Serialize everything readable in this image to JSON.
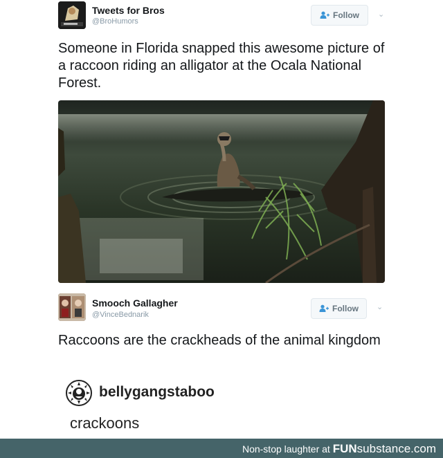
{
  "tweet1": {
    "name": "Tweets for Bros",
    "handle": "@BroHumors",
    "follow_label": "Follow",
    "text": "Someone in Florida snapped this awesome picture of a raccoon riding an alligator at the Ocala National Forest."
  },
  "tweet2": {
    "name": "Smooch Gallagher",
    "handle": "@VinceBednarik",
    "follow_label": "Follow",
    "text": "Raccoons are the crackheads of the animal kingdom"
  },
  "tumblr": {
    "username": "bellygangstaboo",
    "post": "crackoons"
  },
  "footer": {
    "tagline": "Non-stop laughter at ",
    "brand_bold": "FUN",
    "brand_light": "substance",
    "brand_suffix": ".com"
  },
  "icons": {
    "follow": "add-user-icon",
    "more": "chevron-down-icon"
  },
  "colors": {
    "footer_bg": "#456469",
    "handle": "#8899a6",
    "button_text": "#66757f"
  }
}
